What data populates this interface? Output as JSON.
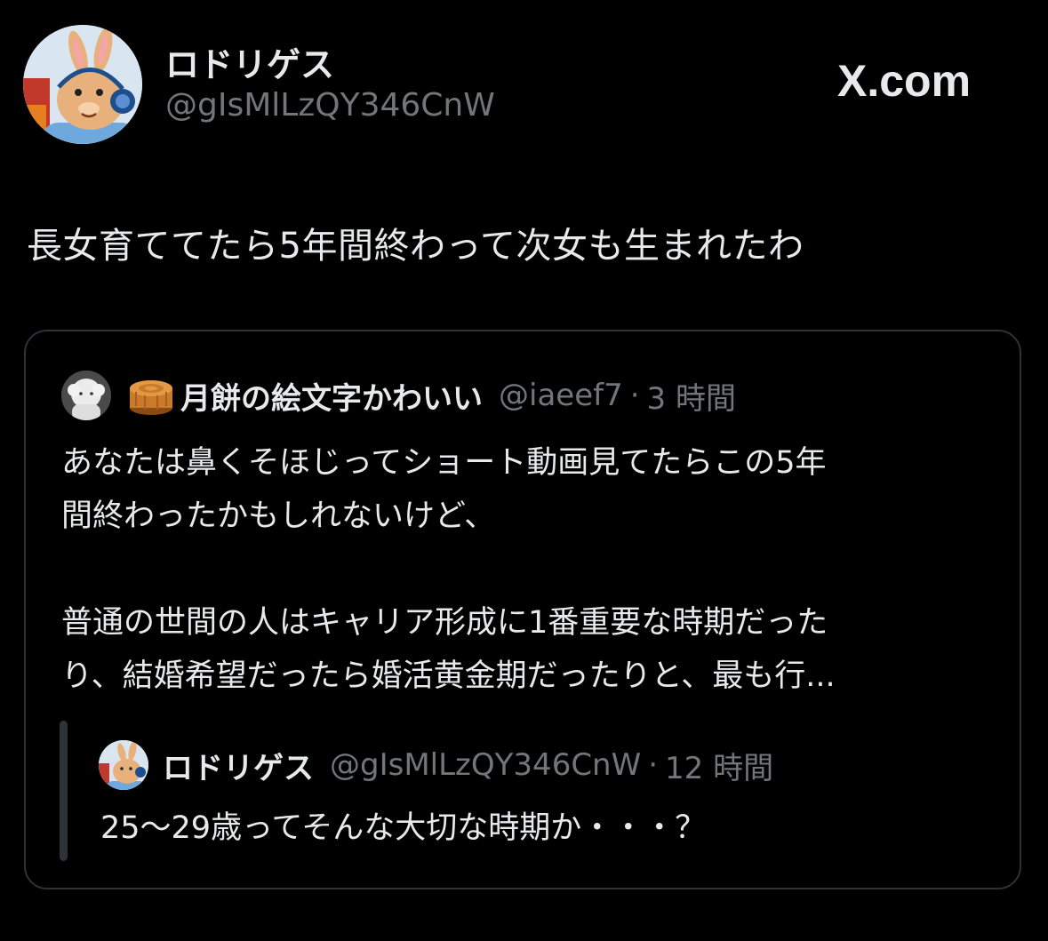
{
  "author": {
    "display_name": "ロドリゲス",
    "handle": "@gIsMlLzQY346CnW",
    "avatar_icon": "rabbit-avatar-icon"
  },
  "brand": {
    "label": "X.com",
    "icon": "x-logo-icon"
  },
  "tweet": {
    "text": "長女育ててたら5年間終わって次女も生まれたわ"
  },
  "quote": {
    "avatar_icon": "plush-avatar-icon",
    "emoji_icon": "mooncake-icon",
    "display_name": "月餅の絵文字かわいい",
    "handle": "@iaeef7",
    "separator": "·",
    "time": "3 時間",
    "lines": [
      "あなたは鼻くそほじってショート動画見てたらこの5年",
      "間終わったかもしれないけど、",
      "",
      "普通の世間の人はキャリア形成に1番重要な時期だった",
      "り、結婚希望だったら婚活黄金期だったりと、最も行..."
    ],
    "nested": {
      "avatar_icon": "rabbit-avatar-icon",
      "display_name": "ロドリゲス",
      "handle": "@gIsMlLzQY346CnW",
      "separator": "·",
      "time": "12 時間",
      "text": "25〜29歳ってそんな大切な時期か・・・？"
    }
  },
  "colors": {
    "background": "#000000",
    "primary_text": "#e7e9ea",
    "secondary_text": "#71767b",
    "border": "#2f3336"
  }
}
